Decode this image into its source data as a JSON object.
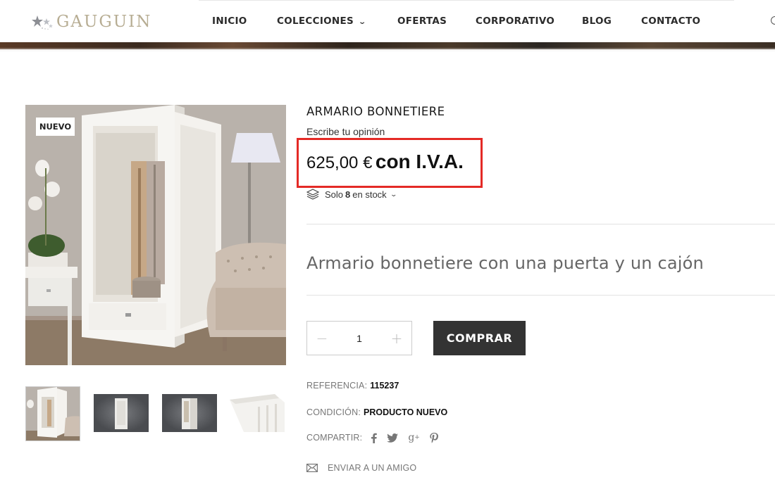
{
  "header": {
    "logo_text": "GAUGUIN",
    "nav": [
      {
        "label": "INICIO"
      },
      {
        "label": "COLECCIONES",
        "has_dropdown": true
      },
      {
        "label": "OFERTAS"
      },
      {
        "label": "CORPORATIVO"
      },
      {
        "label": "BLOG"
      },
      {
        "label": "CONTACTO"
      }
    ]
  },
  "product": {
    "badge": "NUEVO",
    "title": "ARMARIO BONNETIERE",
    "review_link": "Escribe tu opinión",
    "price_amount": "625,00 €",
    "price_suffix": "con I.V.A.",
    "stock_prefix": "Solo",
    "stock_count": "8",
    "stock_suffix": "en stock",
    "short_description": "Armario bonnetiere con una puerta y un cajón",
    "quantity": "1",
    "qty_minus": "−",
    "qty_plus": "+",
    "buy_label": "COMPRAR",
    "reference_label": "REFERENCIA:",
    "reference_value": "115237",
    "condition_label": "CONDICIÓN:",
    "condition_value": "PRODUCTO NUEVO",
    "share_label": "COMPARTIR:",
    "share_icons": [
      "facebook-icon",
      "twitter-icon",
      "google-plus-icon",
      "pinterest-icon"
    ],
    "send_friend": "ENVIAR A UN AMIGO"
  },
  "colors": {
    "highlight_border": "#e42a26",
    "buy_button": "#333333",
    "logo": "#b7ad93"
  }
}
